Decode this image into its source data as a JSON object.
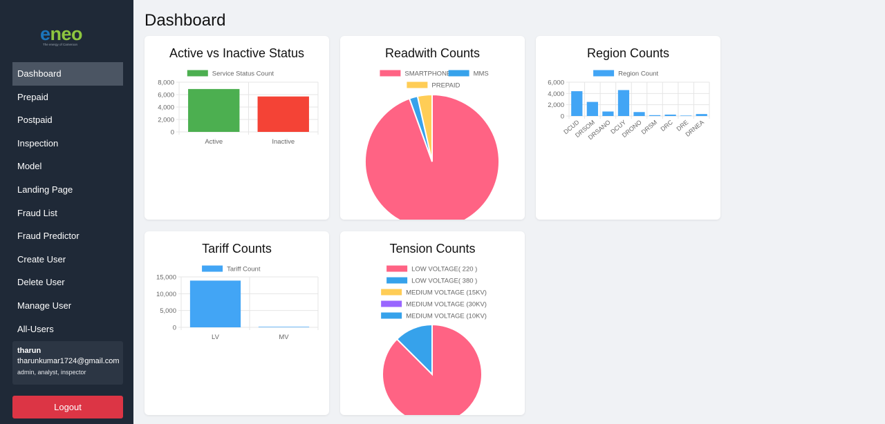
{
  "sidebar": {
    "logo_text": "eneo",
    "logo_tagline": "The energy of Cameroon",
    "items": [
      {
        "label": "Dashboard",
        "active": true
      },
      {
        "label": "Prepaid"
      },
      {
        "label": "Postpaid"
      },
      {
        "label": "Inspection"
      },
      {
        "label": "Model"
      },
      {
        "label": "Landing Page"
      },
      {
        "label": "Fraud List"
      },
      {
        "label": "Fraud Predictor"
      },
      {
        "label": "Create User"
      },
      {
        "label": "Delete User"
      },
      {
        "label": "Manage User"
      },
      {
        "label": "All-Users"
      }
    ],
    "user": {
      "name": "tharun",
      "email": "tharunkumar1724@gmail.com",
      "roles": "admin, analyst, inspector"
    },
    "logout_label": "Logout"
  },
  "page": {
    "title": "Dashboard"
  },
  "colors": {
    "sidebar_bg": "#1f2937",
    "active_item": "#4b5563",
    "logout": "#dc3545",
    "green": "#4caf50",
    "red": "#f44336",
    "blue": "#42a5f5",
    "pink": "#ff6384",
    "yellow": "#ffcd56",
    "purple": "#9966ff",
    "teal": "#36a2eb"
  },
  "chart_data": [
    {
      "id": "status",
      "type": "bar",
      "title": "Active vs Inactive Status",
      "legend": [
        "Service Status Count"
      ],
      "categories": [
        "Active",
        "Inactive"
      ],
      "values": [
        6900,
        5700
      ],
      "bar_colors": [
        "#4caf50",
        "#f44336"
      ],
      "ylim": [
        0,
        8000
      ],
      "yticks": [
        "0",
        "2,000",
        "4,000",
        "6,000",
        "8,000"
      ]
    },
    {
      "id": "readwith",
      "type": "pie",
      "title": "Readwith Counts",
      "legend": [
        "SMARTPHONE",
        "MMS",
        "PREPAID"
      ],
      "values": [
        94.5,
        2,
        3.5
      ],
      "colors": [
        "#ff6384",
        "#36a2eb",
        "#ffcd56"
      ]
    },
    {
      "id": "region",
      "type": "bar",
      "title": "Region Counts",
      "legend": [
        "Region Count"
      ],
      "categories": [
        "DCUD",
        "DRSOM",
        "DRSANO",
        "DCUY",
        "DRONO",
        "DRSM",
        "DRC",
        "DRE",
        "DRNEA"
      ],
      "values": [
        4400,
        2500,
        800,
        4600,
        700,
        150,
        250,
        80,
        350
      ],
      "bar_colors": [
        "#42a5f5"
      ],
      "ylim": [
        0,
        6000
      ],
      "yticks": [
        "0",
        "2,000",
        "4,000",
        "6,000"
      ]
    },
    {
      "id": "tariff",
      "type": "bar",
      "title": "Tariff Counts",
      "legend": [
        "Tariff Count"
      ],
      "categories": [
        "LV",
        "MV"
      ],
      "values": [
        13900,
        150
      ],
      "bar_colors": [
        "#42a5f5"
      ],
      "ylim": [
        0,
        15000
      ],
      "yticks": [
        "0",
        "5,000",
        "10,000",
        "15,000"
      ]
    },
    {
      "id": "tension",
      "type": "pie",
      "title": "Tension Counts",
      "legend": [
        "LOW VOLTAGE( 220 )",
        "LOW VOLTAGE( 380 )",
        "MEDIUM VOLTAGE (15KV)",
        "MEDIUM VOLTAGE (30KV)",
        "MEDIUM VOLTAGE (10KV)"
      ],
      "values": [
        87.5,
        12.5,
        0,
        0,
        0
      ],
      "colors": [
        "#ff6384",
        "#36a2eb",
        "#ffcd56",
        "#9966ff",
        "#36a2eb"
      ]
    }
  ]
}
